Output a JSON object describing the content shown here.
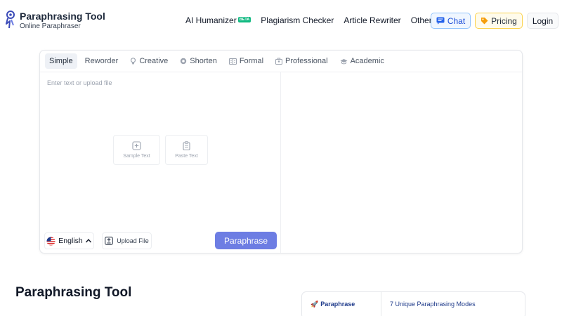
{
  "brand": {
    "title": "Paraphrasing Tool",
    "subtitle": "Online Paraphraser"
  },
  "nav": {
    "items": [
      {
        "label": "AI Humanizer",
        "badge": "BETA"
      },
      {
        "label": "Plagiarism Checker"
      },
      {
        "label": "Article Rewriter"
      },
      {
        "label": "Other Tools"
      }
    ],
    "chat_label": "Chat",
    "pricing_label": "Pricing",
    "login_label": "Login"
  },
  "modes": [
    {
      "label": "Simple",
      "icon": "none",
      "active": true
    },
    {
      "label": "Reworder",
      "icon": "none",
      "active": false
    },
    {
      "label": "Creative",
      "icon": "lightbulb-icon",
      "active": false
    },
    {
      "label": "Shorten",
      "icon": "shorten-icon",
      "active": false
    },
    {
      "label": "Formal",
      "icon": "formal-icon",
      "active": false
    },
    {
      "label": "Professional",
      "icon": "briefcase-icon",
      "active": false
    },
    {
      "label": "Academic",
      "icon": "graduation-cap-icon",
      "active": false
    }
  ],
  "editor": {
    "placeholder": "Enter text or upload file",
    "value": "",
    "sample_label": "Sample Text",
    "paste_label": "Paste Text",
    "language": "English",
    "upload_label": "Upload File",
    "paraphrase_label": "Paraphrase"
  },
  "content": {
    "heading": "Paraphrasing Tool",
    "feature": {
      "name": "Paraphrase",
      "description": "7 Unique Paraphrasing Modes",
      "icon": "rocket-icon"
    }
  },
  "colors": {
    "accent": "#6d7de3",
    "beta_badge": "#10b981",
    "chat_border": "#93c5fd",
    "pricing_border": "#fcd34d"
  }
}
